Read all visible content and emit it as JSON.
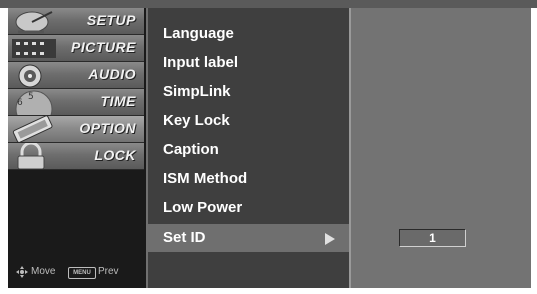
{
  "tabs": [
    {
      "label": "SETUP",
      "icon": "satellite-dish-icon",
      "selected": false
    },
    {
      "label": "PICTURE",
      "icon": "film-icon",
      "selected": false
    },
    {
      "label": "AUDIO",
      "icon": "speaker-icon",
      "selected": false
    },
    {
      "label": "TIME",
      "icon": "clock-icon",
      "selected": false
    },
    {
      "label": "OPTION",
      "icon": "option-sign-icon",
      "selected": true
    },
    {
      "label": "LOCK",
      "icon": "padlock-icon",
      "selected": false
    }
  ],
  "nav": {
    "move_label": "Move",
    "menu_key": "MENU",
    "prev_label": "Prev"
  },
  "menu": {
    "items": [
      {
        "label": "Language"
      },
      {
        "label": "Input label"
      },
      {
        "label": "SimpLink"
      },
      {
        "label": "Key Lock"
      },
      {
        "label": "Caption"
      },
      {
        "label": "ISM Method"
      },
      {
        "label": "Low Power"
      },
      {
        "label": "Set ID",
        "selected": true
      }
    ]
  },
  "set_id": {
    "value": "1"
  },
  "colors": {
    "left_panel": "#1a1a1a",
    "menu_panel": "#3f3f3f",
    "selected_row": "#6f6f6f",
    "value_panel": "#737373"
  }
}
